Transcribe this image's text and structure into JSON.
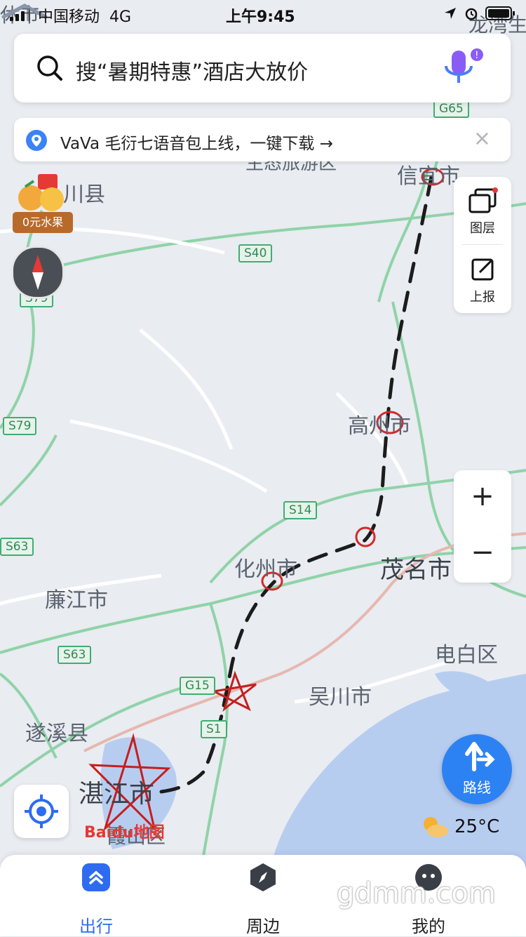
{
  "status_bar": {
    "carrier": "中国移动",
    "network": "4G",
    "time": "上午9:45"
  },
  "search": {
    "placeholder": "搜“暑期特惠”酒店大放价",
    "icon": "search-icon",
    "mic_icon": "voice-mic-icon"
  },
  "banner": {
    "text": "VaVa 毛衍七语音包上线，一键下载 →",
    "close": "×"
  },
  "fruit_promo": {
    "label": "0元水果"
  },
  "side_panel": {
    "layers_label": "图层",
    "report_label": "上报"
  },
  "zoom": {
    "in": "+",
    "out": "−"
  },
  "route_button": {
    "label": "路线"
  },
  "weather": {
    "temp": "25°C"
  },
  "map": {
    "places": {
      "xinyi": "信宜市",
      "xian_top": "川县",
      "gaozhou": "高州市",
      "huazhou": "化州市",
      "maoming": "茂名市",
      "lianjiang": "廉江市",
      "dianbai": "电白区",
      "wuchuan": "吴川市",
      "suixi": "遂溪县",
      "zhanjiang": "湛江市",
      "xiashan": "霞山区",
      "top_right": "龙湾生",
      "top_left": "休市",
      "scenic": "生态旅游区"
    },
    "roads": {
      "g65": "G65",
      "s40": "S40",
      "s79a": "S79",
      "s79b": "S79",
      "s14": "S14",
      "s63a": "S63",
      "s63b": "S63",
      "g15": "G15",
      "s1": "S1"
    },
    "logo": "Baidu地图"
  },
  "tabs": [
    {
      "label": "出行",
      "icon": "travel-icon",
      "active": true
    },
    {
      "label": "周边",
      "icon": "compass-icon",
      "active": false
    },
    {
      "label": "我的",
      "icon": "profile-icon",
      "active": false
    }
  ],
  "watermark": "gdmm.com",
  "colors": {
    "accent": "#2d82f3",
    "highway_green": "#3fae72",
    "water": "#b7cdf0",
    "annotation_red": "#d12a2a"
  }
}
